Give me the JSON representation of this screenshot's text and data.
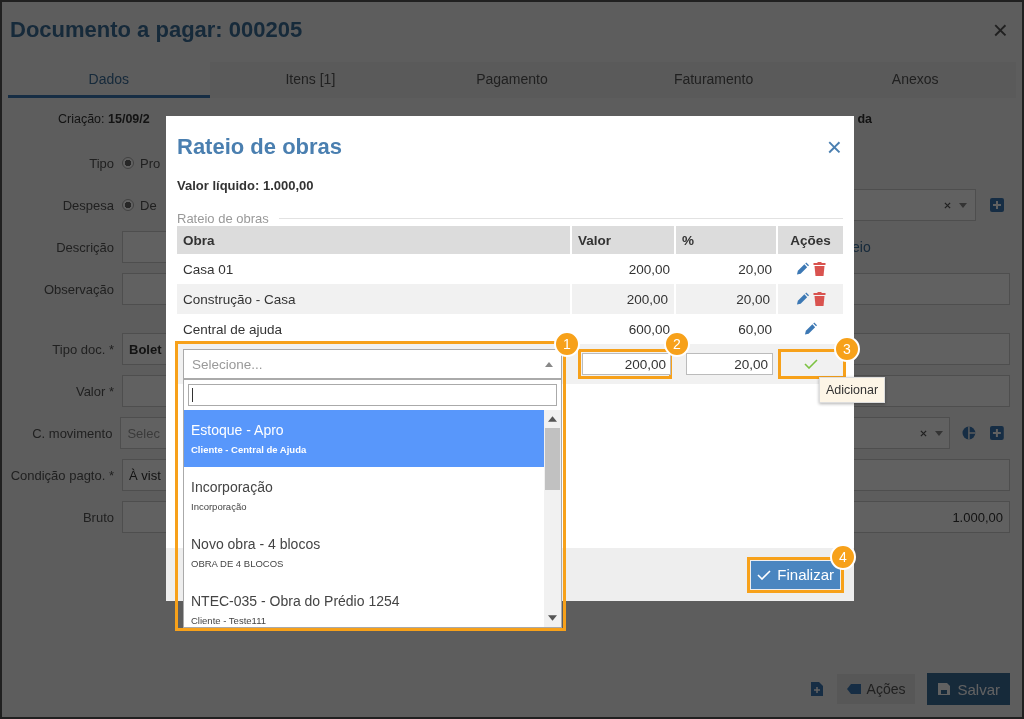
{
  "page": {
    "title": "Documento a pagar: 000205",
    "close": "×",
    "tabs": [
      {
        "label": "Dados",
        "selected": true
      },
      {
        "label": "Itens [1]",
        "selected": false
      },
      {
        "label": "Pagamento",
        "selected": false
      },
      {
        "label": "Faturamento",
        "selected": false
      },
      {
        "label": "Anexos",
        "selected": false
      }
    ],
    "info": {
      "label": "Criação:",
      "value": "15/09/2",
      "right_text": "da"
    },
    "form": [
      [
        {
          "label": "Tipo",
          "kind": "radio",
          "checked": true,
          "value": "Pro"
        },
        {
          "label": "Despesa",
          "kind": "radio",
          "checked": true,
          "value": "De",
          "select": true,
          "add": true
        },
        {
          "label": "Descrição",
          "kind": "field",
          "right_text": "eio"
        },
        {
          "label": "Observação",
          "kind": "field"
        }
      ],
      [
        {
          "label": "Tipo doc. *",
          "kind": "field",
          "value": "Bolet"
        },
        {
          "label": "Valor *",
          "kind": "field"
        },
        {
          "label": "C. movimento",
          "kind": "field",
          "placeholder": "Selec",
          "select": true,
          "pie": true,
          "add": true
        },
        {
          "label": "Condição pagto. *",
          "kind": "field",
          "value": "À vist"
        },
        {
          "label": "Bruto",
          "kind": "field",
          "right_value": "1.000,00"
        }
      ]
    ],
    "footer": {
      "actions": "Ações",
      "save": "Salvar"
    }
  },
  "modal": {
    "title": "Rateio de obras",
    "close": "×",
    "net_value": "Valor líquido: 1.000,00",
    "legend": "Rateio de obras",
    "columns": [
      "Obra",
      "Valor",
      "%",
      "Ações"
    ],
    "rows": [
      {
        "obra": "Casa 01",
        "valor": "200,00",
        "percent": "20,00",
        "actions": [
          {
            "kind": "edit"
          },
          {
            "kind": "delete"
          }
        ]
      },
      {
        "obra": "Construção - Casa",
        "valor": "200,00",
        "percent": "20,00",
        "actions": [
          {
            "kind": "edit"
          },
          {
            "kind": "delete"
          }
        ]
      },
      {
        "obra": "Central de ajuda",
        "valor": "600,00",
        "percent": "60,00",
        "actions": [
          {
            "kind": "edit"
          }
        ]
      }
    ],
    "new_row": {
      "select": {
        "placeholder": "Selecione...",
        "annotation": "1"
      },
      "valor": {
        "value": "200,00",
        "annotation": "2"
      },
      "percent": {
        "value": "20,00"
      },
      "add": {
        "annotation": "3",
        "tooltip": "Adicionar"
      }
    },
    "dropdown": [
      {
        "title": "Estoque - Apro",
        "subtitle": "Cliente - Central de Ajuda",
        "selected": true
      },
      {
        "title": "Incorporação",
        "subtitle": "Incorporação",
        "selected": false
      },
      {
        "title": "Novo obra - 4 blocos",
        "subtitle": "OBRA DE 4 BLOCOS",
        "selected": false
      },
      {
        "title": "NTEC-035 - Obra do Prédio 1254",
        "subtitle": "Cliente - Teste111",
        "selected": false
      }
    ],
    "finish": {
      "label": "Finalizar",
      "annotation": "4"
    }
  }
}
